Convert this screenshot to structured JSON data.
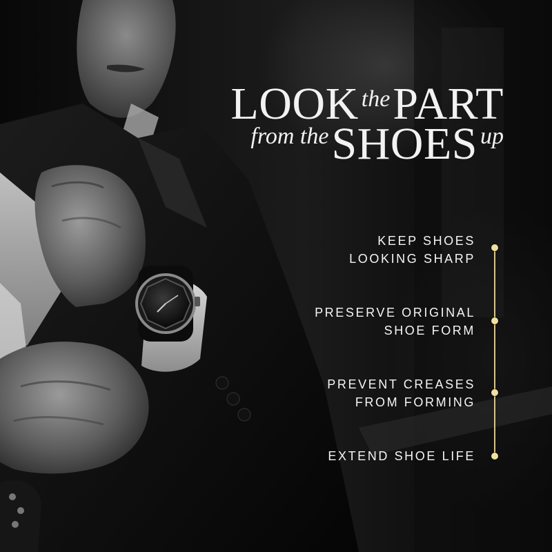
{
  "headline": {
    "look": "LOOK",
    "the": "the",
    "part": "PART",
    "from_the": "from the",
    "shoes": "SHOES",
    "up": "up"
  },
  "benefits": [
    {
      "line1": "KEEP SHOES",
      "line2": "LOOKING SHARP"
    },
    {
      "line1": "PRESERVE ORIGINAL",
      "line2": "SHOE FORM"
    },
    {
      "line1": "PREVENT CREASES",
      "line2": "FROM FORMING"
    },
    {
      "line1": "EXTEND SHOE LIFE",
      "line2": ""
    }
  ],
  "colors": {
    "accent_gold": "#f1e0a0",
    "timeline_gold": "#d8c58a",
    "text_light": "#f5f5f5"
  },
  "image": {
    "subject": "man-in-suit-adjusting-cuff-with-wristwatch",
    "style": "black-and-white-photograph"
  }
}
